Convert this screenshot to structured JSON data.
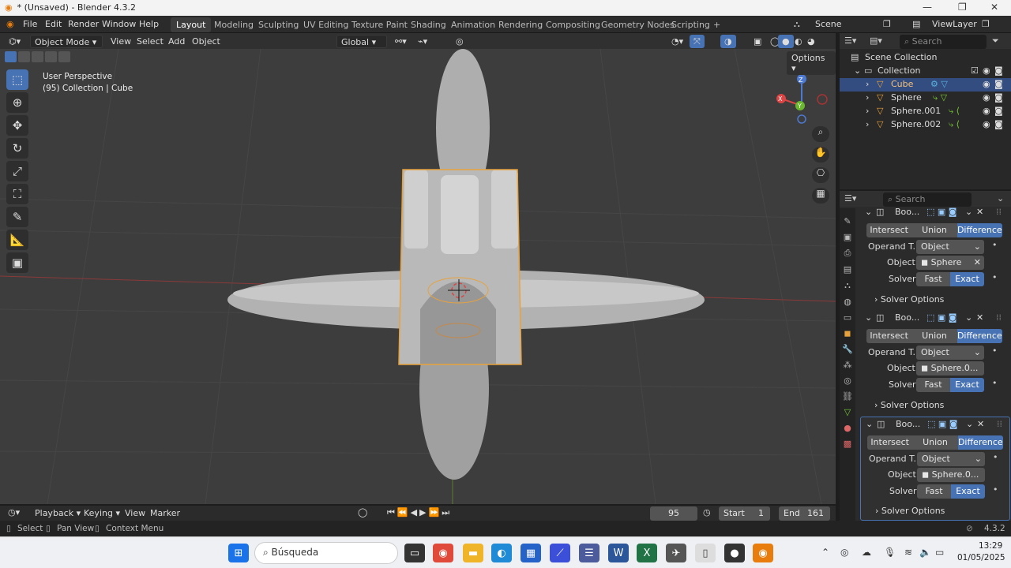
{
  "window": {
    "title": "* (Unsaved) - Blender 4.3.2"
  },
  "menu": [
    "File",
    "Edit",
    "Render",
    "Window",
    "Help"
  ],
  "workspaces": [
    "Layout",
    "Modeling",
    "Sculpting",
    "UV Editing",
    "Texture Paint",
    "Shading",
    "Animation",
    "Rendering",
    "Compositing",
    "Geometry Nodes",
    "Scripting"
  ],
  "add_workspace": "+",
  "scene": {
    "name": "Scene",
    "view_layer": "ViewLayer"
  },
  "viewport_header": {
    "mode": "Object Mode",
    "view": "View",
    "select": "Select",
    "add": "Add",
    "object": "Object",
    "orientation": "Global",
    "options": "Options"
  },
  "viewport": {
    "perspective": "User Perspective",
    "collection_info": "(95) Collection | Cube"
  },
  "gizmo": {
    "z": "Z",
    "y": "Y",
    "x": "X"
  },
  "outliner": {
    "search_placeholder": "Search",
    "scene_collection": "Scene Collection",
    "collection": "Collection",
    "items": [
      "Cube",
      "Sphere",
      "Sphere.001",
      "Sphere.002"
    ]
  },
  "properties": {
    "search_placeholder": "Search",
    "modifiers": [
      {
        "name": "Boo...",
        "ops": [
          "Intersect",
          "Union",
          "Difference"
        ],
        "active_op": "Difference",
        "operand_label": "Operand T...",
        "operand_value": "Object",
        "object_label": "Object",
        "object_value": "Sphere",
        "solver_label": "Solver",
        "solvers": [
          "Fast",
          "Exact"
        ],
        "active_solver": "Exact",
        "solver_options": "Solver Options"
      },
      {
        "name": "Boo...",
        "ops": [
          "Intersect",
          "Union",
          "Difference"
        ],
        "active_op": "Difference",
        "operand_label": "Operand T...",
        "operand_value": "Object",
        "object_label": "Object",
        "object_value": "Sphere.0...",
        "solver_label": "Solver",
        "solvers": [
          "Fast",
          "Exact"
        ],
        "active_solver": "Exact",
        "solver_options": "Solver Options"
      },
      {
        "name": "Boo...",
        "ops": [
          "Intersect",
          "Union",
          "Difference"
        ],
        "active_op": "Difference",
        "operand_label": "Operand T...",
        "operand_value": "Object",
        "object_label": "Object",
        "object_value": "Sphere.0...",
        "solver_label": "Solver",
        "solvers": [
          "Fast",
          "Exact"
        ],
        "active_solver": "Exact",
        "solver_options": "Solver Options"
      }
    ]
  },
  "timeline": {
    "playback": "Playback",
    "keying": "Keying",
    "view": "View",
    "marker": "Marker",
    "current_frame": "95",
    "start_label": "Start",
    "start": "1",
    "end_label": "End",
    "end": "161"
  },
  "statusbar": {
    "select": "Select",
    "pan": "Pan View",
    "context": "Context Menu",
    "version": "4.3.2"
  },
  "taskbar": {
    "search": "Búsqueda",
    "time": "13:29",
    "date": "01/05/2025"
  },
  "colors": {
    "accent": "#4772b3",
    "selected_outline": "#e8a23c",
    "background": "#3d3d3d"
  }
}
